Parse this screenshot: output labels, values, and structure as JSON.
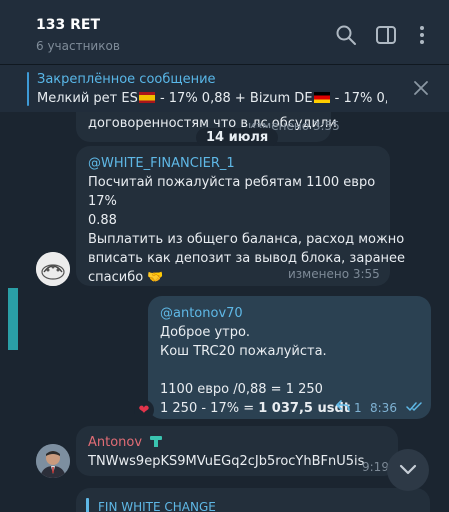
{
  "header": {
    "title": "133 RET",
    "subtitle": "6 участников",
    "icons": [
      "search-icon",
      "sidebar-toggle-icon",
      "more-vertical-icon"
    ]
  },
  "pinned": {
    "title": "Закреплённое сообщение",
    "text_part1": "Мелкий рет ES",
    "text_part2": " - 17% 0,88 + Bizum DE",
    "text_part3": " - 17% 0,8..."
  },
  "messages": {
    "partial_top": {
      "text": "договоренностям что в лс обсудили",
      "meta": "изменено 3:55"
    },
    "date_separator": "14 июля",
    "msg1": {
      "quote": "@WHITE_FINANCIER_1",
      "lines": [
        "Посчитай пожалуйста ребятам 1100 евро",
        "17%",
        "0.88",
        "Выплатить из общего баланса, расход можно",
        "вписать как депозит за вывод блока, заранее",
        "спасибо"
      ],
      "emoji": "🤝",
      "meta": "изменено 3:55"
    },
    "msg2": {
      "quote": "@antonov70",
      "lines": [
        "Доброе утро.",
        "Кош TRC20 пожалуйста."
      ],
      "calc1": "1100 евро /0,88 = 1 250",
      "calc2_prefix": "1 250 - 17% = ",
      "calc2_bold": "1 037,5 usdt",
      "reply_count": "1",
      "time": "8:36",
      "reaction": "❤"
    },
    "msg3": {
      "sender": "Antonov",
      "text": "TNWws9epKS9MVuEGq2cJb5rocYhBFnU5is",
      "time": "9:19"
    },
    "partial_bottom": {
      "text": "FIN WHITE CHANGE"
    }
  },
  "colors": {
    "background": "#1b2530",
    "header": "#212d3b",
    "incoming": "#232f3b",
    "outgoing": "#2b4152",
    "accent": "#5fb8e6",
    "sender_antonov": "#e06c75"
  }
}
